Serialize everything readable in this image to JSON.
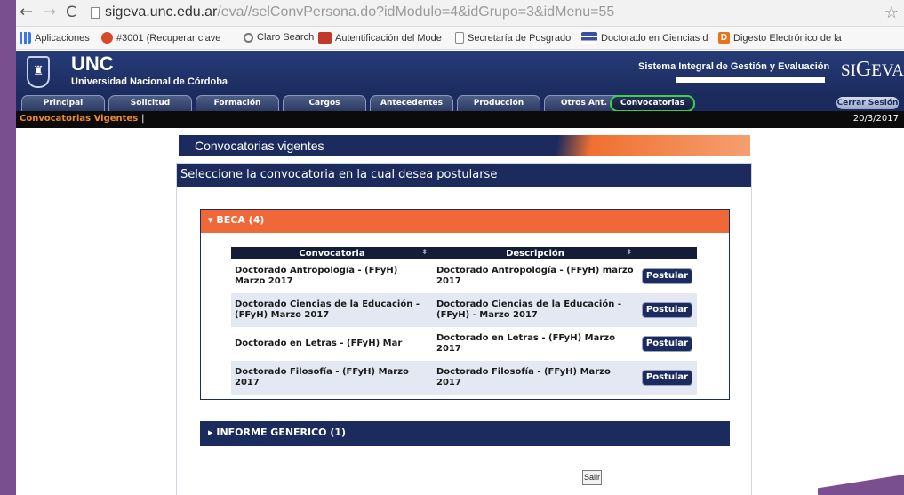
{
  "browser": {
    "url_host": "sigeva.unc.edu.ar",
    "url_path": "/eva//selConvPersona.do?idModulo=4&idGrupo=3&idMenu=55",
    "bookmarks": [
      "Aplicaciones",
      "#3001 (Recuperar clave",
      "Claro Search",
      "Autentificación del Mode",
      "Secretaría de Posgrado",
      "Doctorado en Ciencias d",
      "Digesto Electrónico de la"
    ]
  },
  "header": {
    "logo": "UNC",
    "university": "Universidad Nacional de Córdoba",
    "system": "Sistema Integral de Gestión y Evaluación",
    "brand": "SIGEVA"
  },
  "tabs": [
    "Principal",
    "Solicitud",
    "Formación",
    "Cargos",
    "Antecedentes",
    "Producción",
    "Otros Ant.",
    "Convocatorias"
  ],
  "active_tab": "Convocatorias",
  "logout_label": "Cerrar Sesión",
  "status": {
    "breadcrumb": "Convocatorias Vigentes",
    "separator": "|",
    "date": "20/3/2017"
  },
  "banner_title": "Convocatorias vigentes",
  "panel_title": "Seleccione la convocatoria en la cual desea postularse",
  "sections": {
    "beca": {
      "label": "BECA (4)",
      "expanded": true
    },
    "informe": {
      "label": "INFORME GENERICO (1)",
      "expanded": false
    }
  },
  "table": {
    "headers": [
      "Convocatoria",
      "Descripción"
    ],
    "action_label": "Postular",
    "rows": [
      {
        "convocatoria": "Doctorado Antropología - (FFyH) Marzo 2017",
        "descripcion": "Doctorado Antropología - (FFyH) marzo 2017"
      },
      {
        "convocatoria": "Doctorado Ciencias de la Educación - (FFyH) Marzo 2017",
        "descripcion": "Doctorado Ciencias de la Educación - (FFyH) - Marzo 2017"
      },
      {
        "convocatoria": "Doctorado en Letras - (FFyH) Mar",
        "descripcion": "Doctorado en Letras - (FFyH) Marzo 2017"
      },
      {
        "convocatoria": "Doctorado Filosofía - (FFyH) Marzo 2017",
        "descripcion": "Doctorado Filosofía - (FFyH) Marzo 2017"
      }
    ]
  },
  "exit_label": "Salir",
  "colors": {
    "navy": "#1b2b5e",
    "orange": "#f06838",
    "highlight_green": "#37d14a",
    "frame_purple": "#7a4f90"
  }
}
